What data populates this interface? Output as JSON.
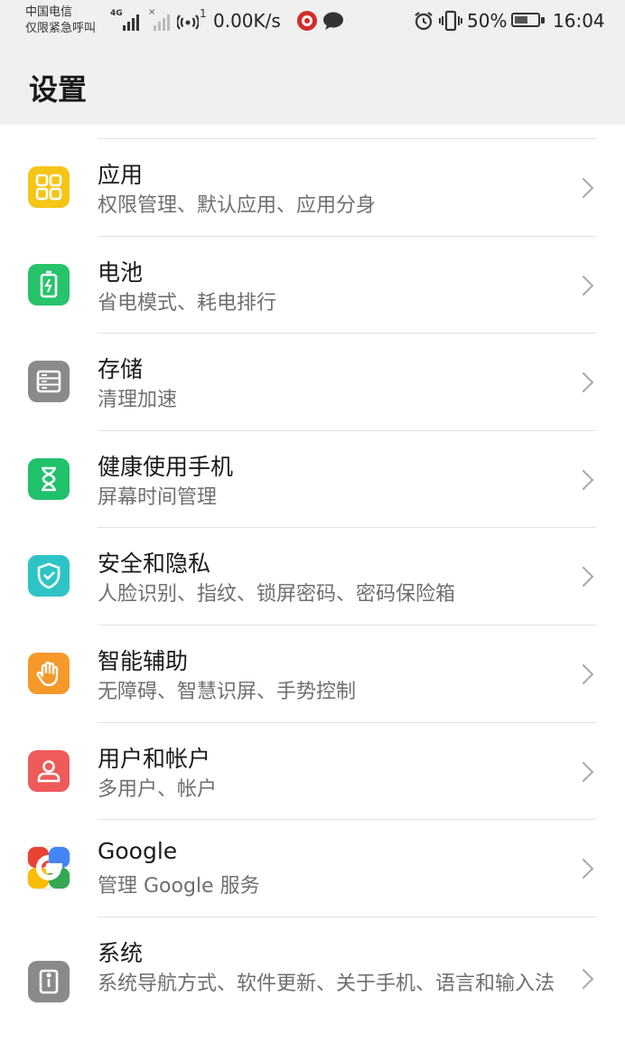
{
  "status_bar": {
    "carrier_line1": "中国电信",
    "carrier_line2": "仅限紧急呼叫",
    "network_type": "4G",
    "hotspot_count": "1",
    "speed": "0.00K/s",
    "battery": "50%",
    "time": "16:04"
  },
  "header": {
    "title": "设置"
  },
  "items": [
    {
      "title": "应用",
      "subtitle": "权限管理、默认应用、应用分身",
      "color": "#f5c518",
      "icon": "apps-grid-icon"
    },
    {
      "title": "电池",
      "subtitle": "省电模式、耗电排行",
      "color": "#27c36a",
      "icon": "battery-icon"
    },
    {
      "title": "存储",
      "subtitle": "清理加速",
      "color": "#8a8a8a",
      "icon": "storage-icon"
    },
    {
      "title": "健康使用手机",
      "subtitle": "屏幕时间管理",
      "color": "#1fc16b",
      "icon": "hourglass-icon"
    },
    {
      "title": "安全和隐私",
      "subtitle": "人脸识别、指纹、锁屏密码、密码保险箱",
      "color": "#2ec4c6",
      "icon": "shield-check-icon"
    },
    {
      "title": "智能辅助",
      "subtitle": "无障碍、智慧识屏、手势控制",
      "color": "#f59a2a",
      "icon": "hand-icon"
    },
    {
      "title": "用户和帐户",
      "subtitle": "多用户、帐户",
      "color": "#ef5a5a",
      "icon": "user-icon"
    },
    {
      "title": "Google",
      "subtitle": "管理 Google 服务",
      "color": "#ffffff",
      "icon": "google-icon"
    },
    {
      "title": "系统",
      "subtitle": "系统导航方式、软件更新、关于手机、语言和输入法",
      "color": "#8a8a8a",
      "icon": "info-icon"
    }
  ]
}
